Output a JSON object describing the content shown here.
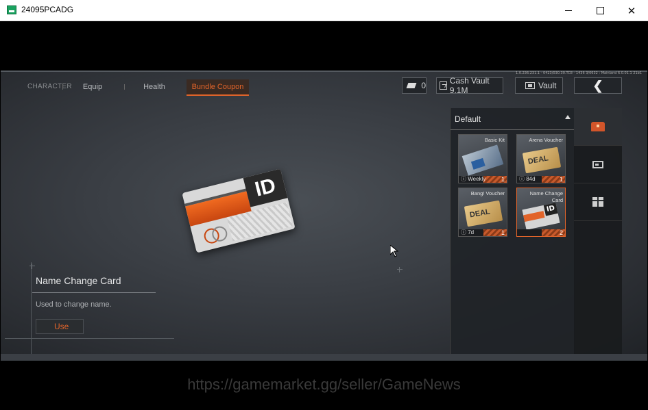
{
  "window": {
    "title": "24095PCADG"
  },
  "game": {
    "build_info": "1.0.236.231.1 - 0423/030.30.TC8 - 1436 3/0632 : Mainland 6.0.01.1 21b1",
    "nav": {
      "character": "CHARACTER",
      "tabs": [
        {
          "label": "Equip",
          "active": false
        },
        {
          "label": "Health",
          "active": false
        },
        {
          "label": "Bundle Coupon",
          "active": true
        }
      ]
    },
    "topbar": {
      "coupon_count": "0",
      "cash_vault": "Cash Vault 9.1M",
      "vault": "Vault"
    },
    "selected_item": {
      "card_text": "ID",
      "name": "Name Change Card",
      "description": "Used to change name.",
      "use_label": "Use"
    },
    "inventory": {
      "category": "Default",
      "items": [
        {
          "name": "Basic Kit",
          "time": "Weekly",
          "qty": "1"
        },
        {
          "name": "Arena Voucher",
          "time": "84d",
          "qty": "1",
          "ticket_text": "DEAL"
        },
        {
          "name": "Bang! Voucher",
          "time": "7d",
          "qty": "1",
          "ticket_text": "DEAL"
        },
        {
          "name": "Name Change Card",
          "time": "",
          "qty": "2"
        }
      ]
    },
    "side_tabs": [
      "chest-icon",
      "card-icon",
      "gift-icon"
    ]
  },
  "watermark": "https://gamemarket.gg/seller/GameNews",
  "colors": {
    "accent": "#e2642a",
    "panel": "#202327"
  }
}
